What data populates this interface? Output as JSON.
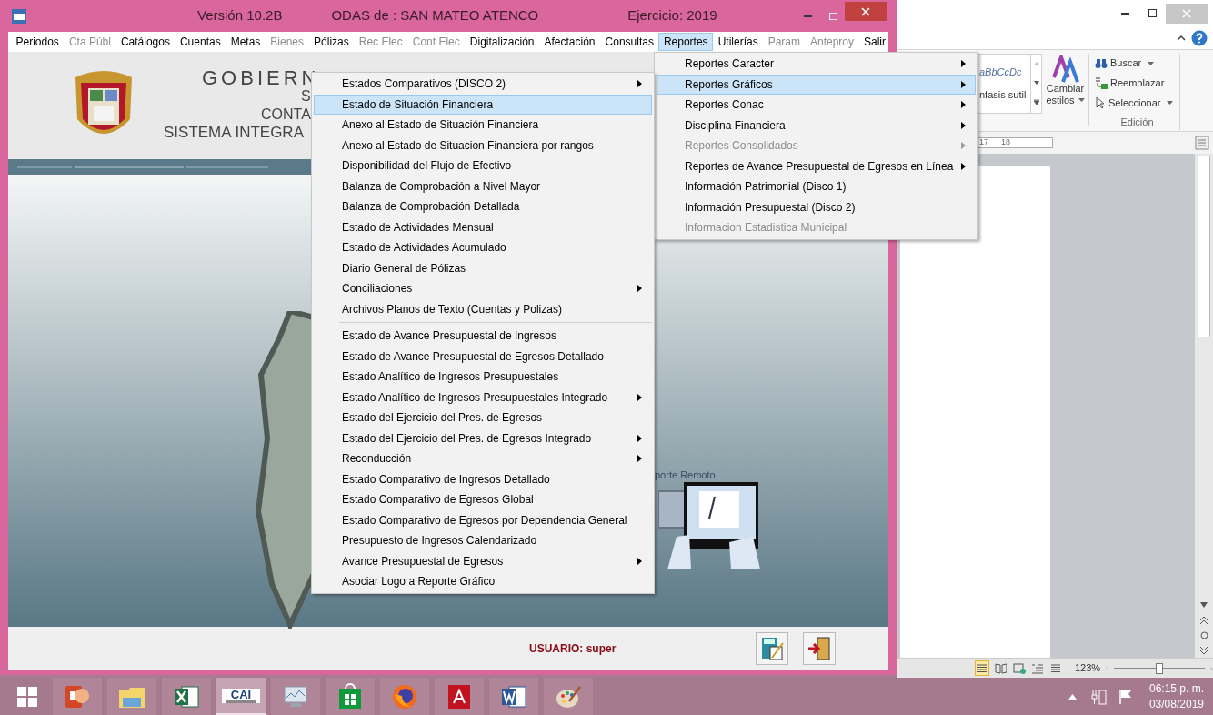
{
  "app_window": {
    "title_parts": [
      "Versión 10.2B",
      "ODAS de : SAN MATEO ATENCO",
      "Ejercicio: 2019"
    ],
    "menu_bar": [
      {
        "label": "Periodos",
        "disabled": false,
        "selected": false
      },
      {
        "label": "Cta Públ",
        "disabled": true,
        "selected": false
      },
      {
        "label": "Catálogos",
        "disabled": false,
        "selected": false
      },
      {
        "label": "Cuentas",
        "disabled": false,
        "selected": false
      },
      {
        "label": "Metas",
        "disabled": false,
        "selected": false
      },
      {
        "label": "Bienes",
        "disabled": true,
        "selected": false
      },
      {
        "label": "Pólizas",
        "disabled": false,
        "selected": false
      },
      {
        "label": "Rec Elec",
        "disabled": true,
        "selected": false
      },
      {
        "label": "Cont Elec",
        "disabled": true,
        "selected": false
      },
      {
        "label": "Digitalización",
        "disabled": false,
        "selected": false
      },
      {
        "label": "Afectación",
        "disabled": false,
        "selected": false
      },
      {
        "label": "Consultas",
        "disabled": false,
        "selected": false
      },
      {
        "label": "Reportes",
        "disabled": false,
        "selected": true
      },
      {
        "label": "Utilerías",
        "disabled": false,
        "selected": false
      },
      {
        "label": "Param",
        "disabled": true,
        "selected": false
      },
      {
        "label": "Anteproy",
        "disabled": true,
        "selected": false
      },
      {
        "label": "Salir",
        "disabled": false,
        "selected": false
      }
    ],
    "header_lines": [
      "GOBIERN",
      "S",
      "CONTA",
      "SISTEMA INTEGRA"
    ],
    "remote_caption": "porte Remoto",
    "status": {
      "user_label": "USUARIO:",
      "user": "super"
    }
  },
  "reportes_menu": [
    {
      "label": "Reportes Caracter",
      "has_submenu": true,
      "disabled": false,
      "selected": false
    },
    {
      "label": "Reportes Gráficos",
      "has_submenu": true,
      "disabled": false,
      "selected": true
    },
    {
      "label": "Reportes Conac",
      "has_submenu": true,
      "disabled": false,
      "selected": false
    },
    {
      "label": "Disciplina Financiera",
      "has_submenu": true,
      "disabled": false,
      "selected": false
    },
    {
      "label": "Reportes Consolidados",
      "has_submenu": true,
      "disabled": true,
      "selected": false
    },
    {
      "label": "Reportes de Avance Presupuestal de Egresos en Línea",
      "has_submenu": true,
      "disabled": false,
      "selected": false
    },
    {
      "label": "Información Patrimonial (Disco 1)",
      "has_submenu": false,
      "disabled": false,
      "selected": false
    },
    {
      "label": "Información Presupuestal (Disco 2)",
      "has_submenu": false,
      "disabled": false,
      "selected": false
    },
    {
      "label": "Informacion Estadistica Municipal",
      "has_submenu": false,
      "disabled": true,
      "selected": false
    }
  ],
  "graficos_menu": [
    {
      "label": "Estados Comparativos (DISCO 2)",
      "has_submenu": true,
      "selected": false,
      "separator_before": false
    },
    {
      "label": "Estado de Situación Financiera",
      "has_submenu": false,
      "selected": true,
      "separator_before": false
    },
    {
      "label": "Anexo al Estado de Situación Financiera",
      "has_submenu": false,
      "selected": false,
      "separator_before": false
    },
    {
      "label": "Anexo al Estado de Situacion Financiera por rangos",
      "has_submenu": false,
      "selected": false,
      "separator_before": false
    },
    {
      "label": "Disponibilidad del Flujo de Efectivo",
      "has_submenu": false,
      "selected": false,
      "separator_before": false
    },
    {
      "label": "Balanza de Comprobación a Nivel Mayor",
      "has_submenu": false,
      "selected": false,
      "separator_before": false
    },
    {
      "label": "Balanza de Comprobación Detallada",
      "has_submenu": false,
      "selected": false,
      "separator_before": false
    },
    {
      "label": "Estado de Actividades Mensual",
      "has_submenu": false,
      "selected": false,
      "separator_before": false
    },
    {
      "label": "Estado de Actividades Acumulado",
      "has_submenu": false,
      "selected": false,
      "separator_before": false
    },
    {
      "label": "Diario General de Pólizas",
      "has_submenu": false,
      "selected": false,
      "separator_before": false
    },
    {
      "label": "Conciliaciones",
      "has_submenu": true,
      "selected": false,
      "separator_before": false
    },
    {
      "label": "Archivos Planos de Texto (Cuentas y Polizas)",
      "has_submenu": false,
      "selected": false,
      "separator_before": false
    },
    {
      "label": "Estado de Avance Presupuestal de Ingresos",
      "has_submenu": false,
      "selected": false,
      "separator_before": true
    },
    {
      "label": "Estado de Avance Presupuestal de Egresos Detallado",
      "has_submenu": false,
      "selected": false,
      "separator_before": false
    },
    {
      "label": "Estado Analítico de Ingresos Presupuestales",
      "has_submenu": false,
      "selected": false,
      "separator_before": false
    },
    {
      "label": "Estado Analítico de Ingresos Presupuestales Integrado",
      "has_submenu": true,
      "selected": false,
      "separator_before": false
    },
    {
      "label": "Estado del Ejercicio del Pres. de Egresos",
      "has_submenu": false,
      "selected": false,
      "separator_before": false
    },
    {
      "label": "Estado del Ejercicio del Pres. de Egresos Integrado",
      "has_submenu": true,
      "selected": false,
      "separator_before": false
    },
    {
      "label": "Reconducción",
      "has_submenu": true,
      "selected": false,
      "separator_before": false
    },
    {
      "label": "Estado Comparativo de Ingresos Detallado",
      "has_submenu": false,
      "selected": false,
      "separator_before": false
    },
    {
      "label": "Estado Comparativo de Egresos Global",
      "has_submenu": false,
      "selected": false,
      "separator_before": false
    },
    {
      "label": "Estado Comparativo de Egresos por Dependencia General",
      "has_submenu": false,
      "selected": false,
      "separator_before": false
    },
    {
      "label": "Presupuesto de Ingresos Calendarizado",
      "has_submenu": false,
      "selected": false,
      "separator_before": false
    },
    {
      "label": "Avance Presupuestal de Egresos",
      "has_submenu": true,
      "selected": false,
      "separator_before": false
    },
    {
      "label": "Asociar Logo a Reporte Gráfico",
      "has_submenu": false,
      "selected": false,
      "separator_before": false
    }
  ],
  "word_window": {
    "style_preview": "aBbCcDc",
    "style_name": "nfasis sutil",
    "change_styles": [
      "Cambiar",
      "estilos"
    ],
    "edit_buttons": [
      {
        "label": "Buscar",
        "kind": "find",
        "has_dropdown": true
      },
      {
        "label": "Reemplazar",
        "kind": "replace",
        "has_dropdown": false
      },
      {
        "label": "Seleccionar",
        "kind": "select",
        "has_dropdown": true
      }
    ],
    "edit_group": "Edición",
    "ruler": [
      "17",
      "18"
    ],
    "views": [
      {
        "kind": "print",
        "selected": true
      },
      {
        "kind": "reading",
        "selected": false
      },
      {
        "kind": "web",
        "selected": false
      },
      {
        "kind": "outline",
        "selected": false
      },
      {
        "kind": "draft",
        "selected": false
      }
    ],
    "zoom": "123%",
    "zoom_slider": {
      "level": 0.5
    }
  },
  "taskbar": {
    "apps": [
      {
        "kind": "powerpoint",
        "selected": false
      },
      {
        "kind": "explorer",
        "selected": false
      },
      {
        "kind": "excel",
        "selected": false
      },
      {
        "kind": "cai",
        "selected": true
      },
      {
        "kind": "monitor",
        "selected": false
      },
      {
        "kind": "store",
        "selected": false
      },
      {
        "kind": "firefox",
        "selected": false
      },
      {
        "kind": "acrobat",
        "selected": false
      },
      {
        "kind": "word",
        "selected": false
      },
      {
        "kind": "paint",
        "selected": false
      }
    ],
    "cai_label": "CAI",
    "clock": {
      "time": "06:15 p. m.",
      "date": "03/08/2019"
    }
  }
}
